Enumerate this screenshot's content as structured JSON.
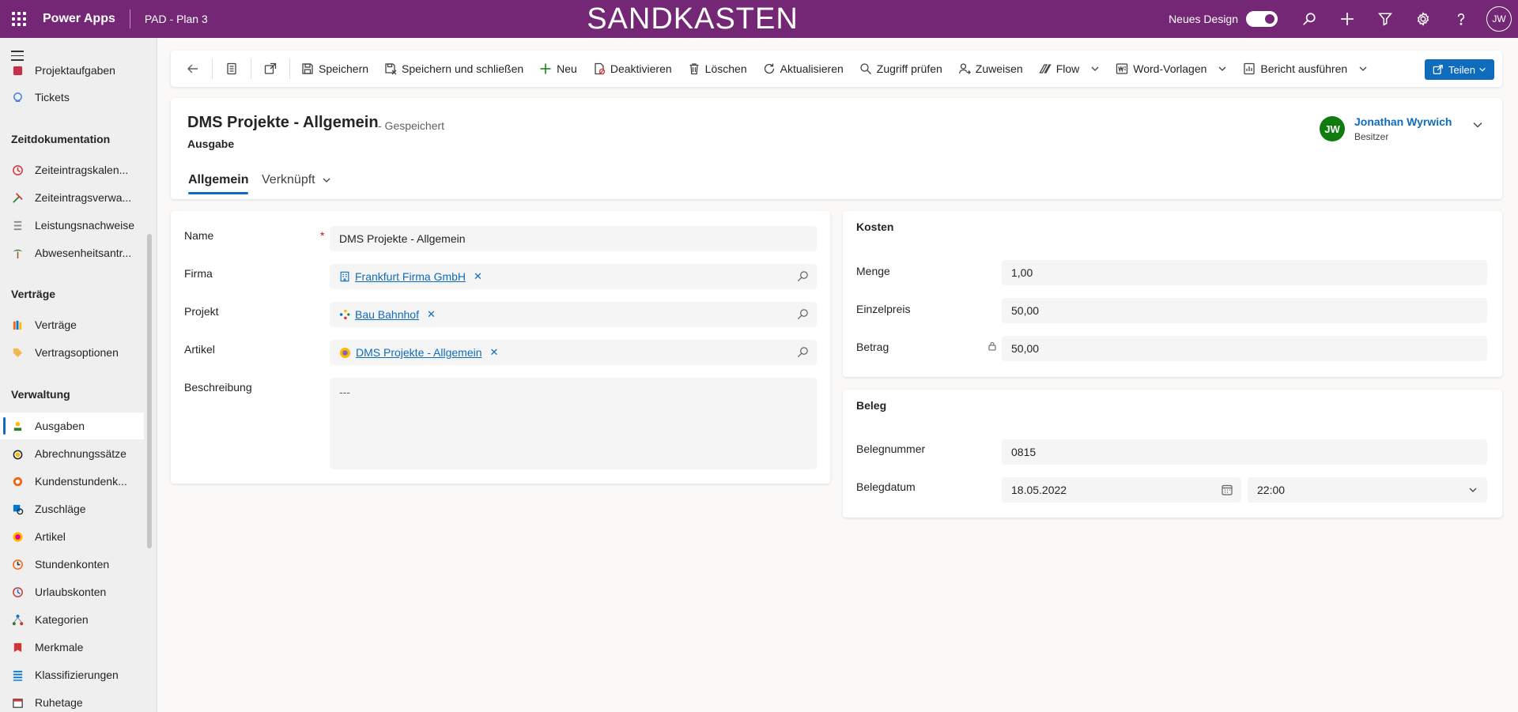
{
  "topbar": {
    "app_name": "Power Apps",
    "env_name": "PAD - Plan 3",
    "banner": "SANDKASTEN",
    "new_design_label": "Neues Design",
    "user_initials": "JW",
    "brand_color": "#742774"
  },
  "sidebar": {
    "top_items": [
      {
        "label": "Projektaufgaben",
        "icon": "task-icon"
      },
      {
        "label": "Tickets",
        "icon": "ticket-icon"
      }
    ],
    "groups": [
      {
        "title": "Zeitdokumentation",
        "items": [
          {
            "label": "Zeiteintragskalen...",
            "icon": "clock-icon"
          },
          {
            "label": "Zeiteintragsverwa...",
            "icon": "tools-icon"
          },
          {
            "label": "Leistungsnachweise",
            "icon": "list-icon"
          },
          {
            "label": "Abwesenheitsantr...",
            "icon": "palm-tree-icon"
          }
        ]
      },
      {
        "title": "Verträge",
        "items": [
          {
            "label": "Verträge",
            "icon": "contract-icon"
          },
          {
            "label": "Vertragsoptionen",
            "icon": "tag-icon"
          }
        ]
      },
      {
        "title": "Verwaltung",
        "items": [
          {
            "label": "Ausgaben",
            "icon": "expense-icon",
            "active": true
          },
          {
            "label": "Abrechnungssätze",
            "icon": "rate-icon"
          },
          {
            "label": "Kundenstundenk...",
            "icon": "customer-hours-icon"
          },
          {
            "label": "Zuschläge",
            "icon": "surcharge-icon"
          },
          {
            "label": "Artikel",
            "icon": "article-icon"
          },
          {
            "label": "Stundenkonten",
            "icon": "hours-account-icon"
          },
          {
            "label": "Urlaubskonten",
            "icon": "vacation-icon"
          },
          {
            "label": "Kategorien",
            "icon": "category-icon"
          },
          {
            "label": "Merkmale",
            "icon": "feature-icon"
          },
          {
            "label": "Klassifizierungen",
            "icon": "classification-icon"
          },
          {
            "label": "Ruhetage",
            "icon": "calendar-icon"
          }
        ]
      }
    ]
  },
  "commands": {
    "save": "Speichern",
    "save_close": "Speichern und schließen",
    "new": "Neu",
    "deactivate": "Deaktivieren",
    "delete": "Löschen",
    "refresh": "Aktualisieren",
    "check_access": "Zugriff prüfen",
    "assign": "Zuweisen",
    "flow": "Flow",
    "word_templates": "Word-Vorlagen",
    "run_report": "Bericht ausführen",
    "share": "Teilen"
  },
  "record": {
    "title": "DMS Projekte - Allgemein",
    "status": "- Gespeichert",
    "entity": "Ausgabe",
    "owner_initials": "JW",
    "owner_name": "Jonathan Wyrwich",
    "owner_role": "Besitzer",
    "tabs": [
      "Allgemein",
      "Verknüpft"
    ]
  },
  "general": {
    "name_label": "Name",
    "name_value": "DMS Projekte - Allgemein",
    "required_mark": "*",
    "firma_label": "Firma",
    "firma_value": "Frankfurt Firma GmbH",
    "projekt_label": "Projekt",
    "projekt_value": "Bau Bahnhof",
    "artikel_label": "Artikel",
    "artikel_value": "DMS Projekte - Allgemein",
    "beschreibung_label": "Beschreibung",
    "beschreibung_value": "---",
    "remove_mark": "✕"
  },
  "kosten": {
    "title": "Kosten",
    "menge_label": "Menge",
    "menge_value": "1,00",
    "einzelpreis_label": "Einzelpreis",
    "einzelpreis_value": "50,00",
    "betrag_label": "Betrag",
    "betrag_value": "50,00"
  },
  "beleg": {
    "title": "Beleg",
    "nummer_label": "Belegnummer",
    "nummer_value": "0815",
    "datum_label": "Belegdatum",
    "datum_value": "18.05.2022",
    "zeit_value": "22:00"
  }
}
